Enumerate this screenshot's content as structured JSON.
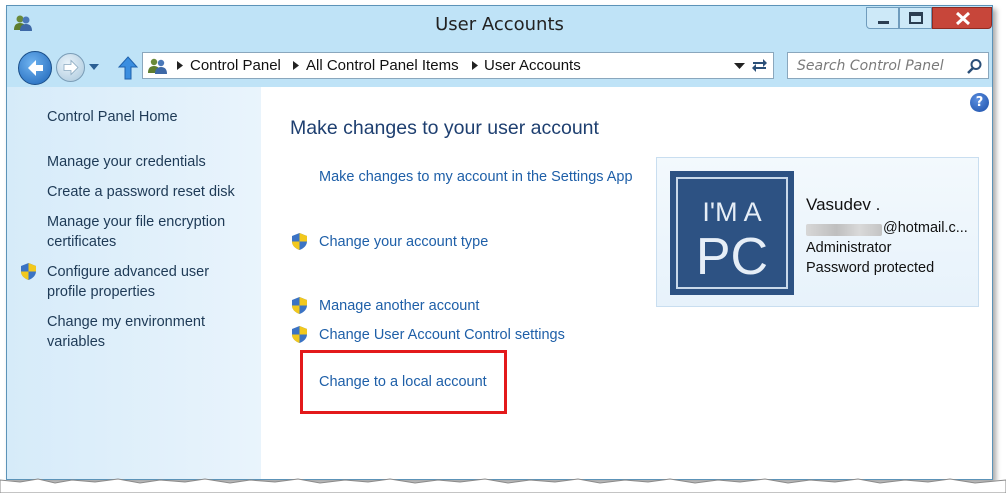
{
  "window": {
    "title": "User Accounts",
    "colors": {
      "frame": "#bfe3f7",
      "close_button": "#c7463a",
      "link": "#1e5fa8",
      "heading": "#1e3f70",
      "highlight_box": "#e3191b"
    },
    "icons": [
      "user-accounts-icon",
      "minimize-icon",
      "maximize-icon",
      "close-icon"
    ]
  },
  "navbar": {
    "breadcrumb": [
      "Control Panel",
      "All Control Panel Items",
      "User Accounts"
    ],
    "search_placeholder": "Search Control Panel",
    "icons": [
      "back-arrow-icon",
      "forward-arrow-icon",
      "recent-pages-icon",
      "up-arrow-icon",
      "control-panel-icon",
      "refresh-icon",
      "search-icon"
    ]
  },
  "sidebar": {
    "items": [
      {
        "label": "Control Panel Home",
        "shield": false
      },
      {
        "label": "Manage your credentials",
        "shield": false
      },
      {
        "label": "Create a password reset disk",
        "shield": false
      },
      {
        "label": "Manage your file encryption certificates",
        "shield": false
      },
      {
        "label": "Configure advanced user profile properties",
        "shield": true
      },
      {
        "label": "Change my environment variables",
        "shield": false
      }
    ]
  },
  "main": {
    "heading": "Make changes to your user account",
    "tasks": [
      {
        "label": "Make changes to my account in the Settings App",
        "shield": false
      },
      {
        "label": "Change your account type",
        "shield": true
      },
      {
        "label": "Manage another account",
        "shield": true
      },
      {
        "label": "Change User Account Control settings",
        "shield": true
      },
      {
        "label": "Change to a local account",
        "shield": false,
        "highlighted": true
      }
    ],
    "help_label": "?"
  },
  "account": {
    "avatar_text": [
      "I'M A",
      "PC"
    ],
    "name": "Vasudev .",
    "email": "@hotmail.c...",
    "role": "Administrator",
    "status": "Password protected"
  }
}
